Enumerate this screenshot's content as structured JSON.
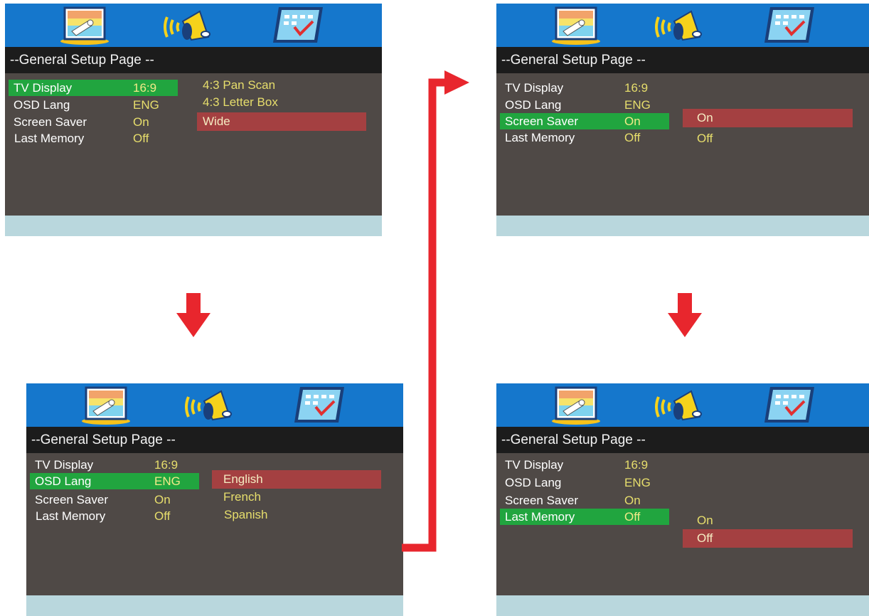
{
  "screens": [
    {
      "title": "--General Setup Page --",
      "rows": [
        {
          "label": "TV Display",
          "value": "16:9"
        },
        {
          "label": "OSD Lang",
          "value": "ENG"
        },
        {
          "label": "Screen Saver",
          "value": "On"
        },
        {
          "label": "Last Memory",
          "value": "Off"
        }
      ],
      "selected_row": "TV Display",
      "options": [
        "4:3 Pan Scan",
        "4:3 Letter Box",
        "Wide"
      ],
      "selected_option": "Wide"
    },
    {
      "title": "--General Setup Page --",
      "rows": [
        {
          "label": "TV Display",
          "value": "16:9"
        },
        {
          "label": "OSD Lang",
          "value": "ENG"
        },
        {
          "label": "Screen Saver",
          "value": "On"
        },
        {
          "label": "Last Memory",
          "value": "Off"
        }
      ],
      "selected_row": "OSD Lang",
      "options": [
        "English",
        "French",
        "Spanish"
      ],
      "selected_option": "English"
    },
    {
      "title": "--General Setup Page --",
      "rows": [
        {
          "label": "TV Display",
          "value": "16:9"
        },
        {
          "label": "OSD Lang",
          "value": "ENG"
        },
        {
          "label": "Screen Saver",
          "value": "On"
        },
        {
          "label": "Last Memory",
          "value": "Off"
        }
      ],
      "selected_row": "Screen Saver",
      "options": [
        "On",
        "Off"
      ],
      "selected_option": "On"
    },
    {
      "title": "--General Setup Page --",
      "rows": [
        {
          "label": "TV Display",
          "value": "16:9"
        },
        {
          "label": "OSD Lang",
          "value": "ENG"
        },
        {
          "label": "Screen Saver",
          "value": "On"
        },
        {
          "label": "Last Memory",
          "value": "Off"
        }
      ],
      "selected_row": "Last Memory",
      "options": [
        "On",
        "Off"
      ],
      "selected_option": "Off"
    }
  ],
  "icons": [
    "general-setup-icon",
    "audio-setup-icon",
    "preference-setup-icon"
  ],
  "colors": {
    "icon_bar": "#1577cc",
    "title_bar": "#1c1c1c",
    "menu_body": "#4f4946",
    "footer": "#b9d7dd",
    "row_highlight": "#21a53f",
    "option_highlight": "#a44041",
    "value_text": "#e7de6c",
    "arrow": "#e8262d"
  }
}
